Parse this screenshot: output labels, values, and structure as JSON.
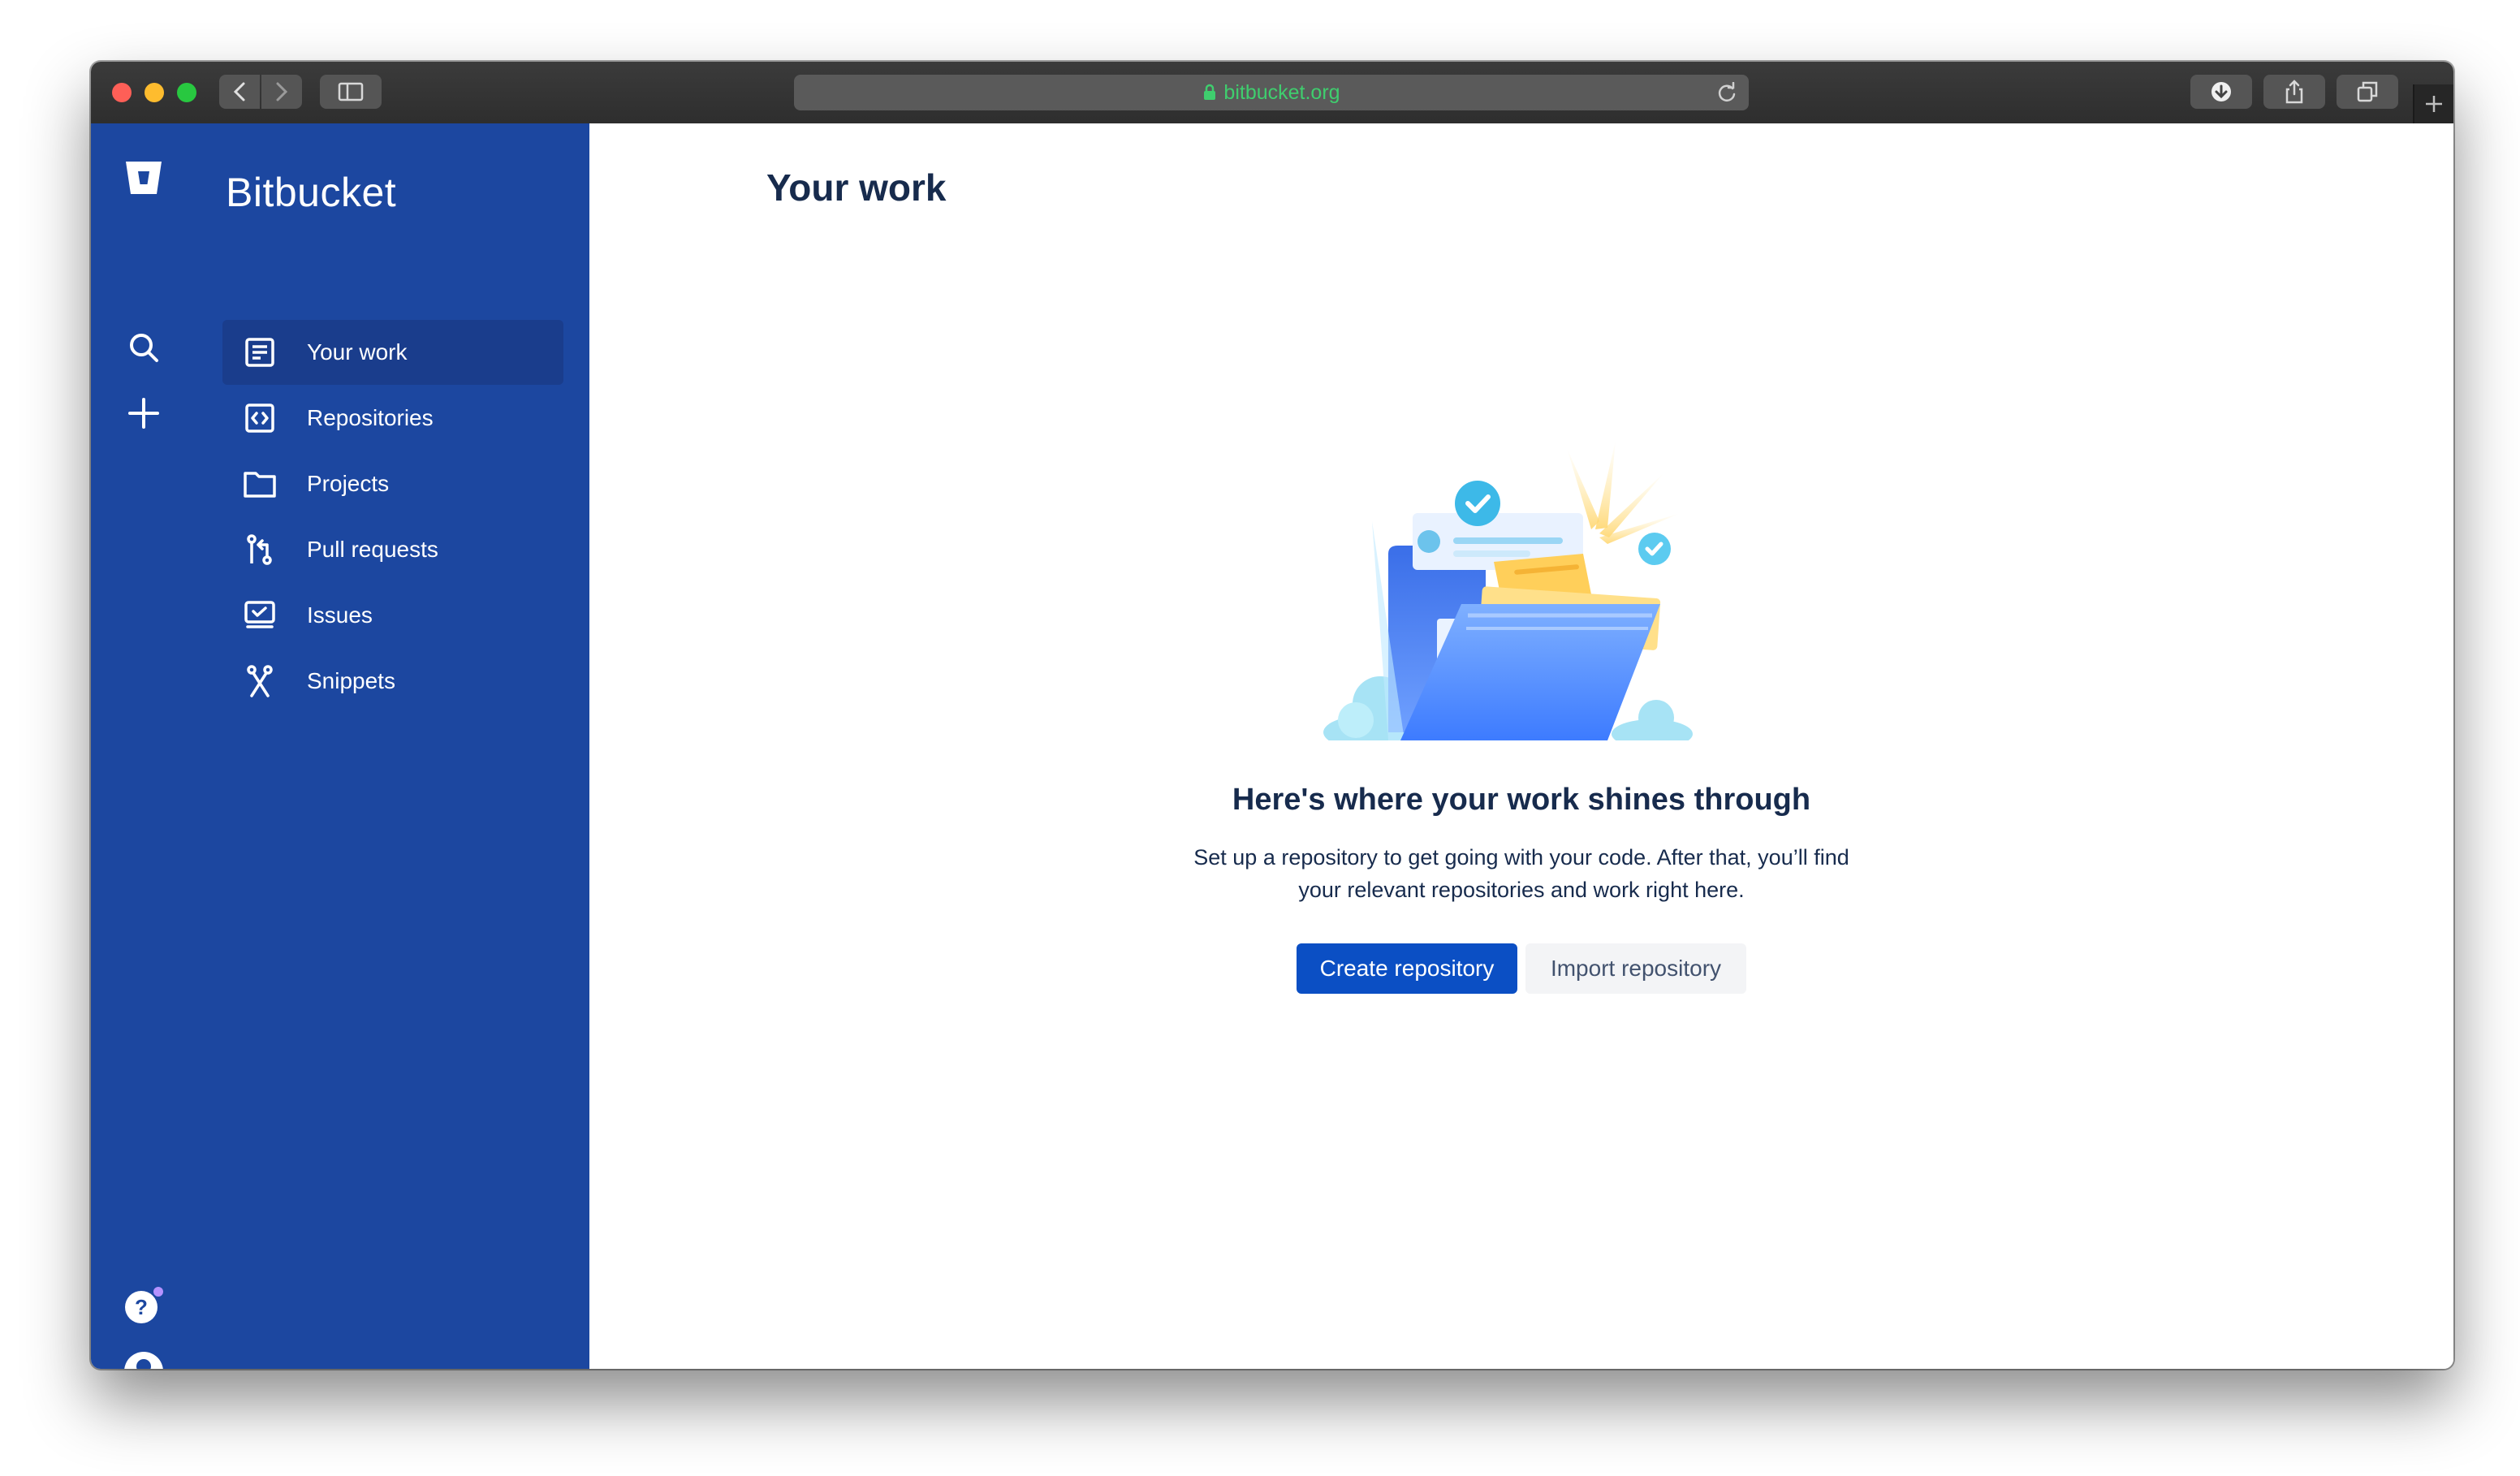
{
  "browser": {
    "url": "bitbucket.org",
    "colors": {
      "url_text": "#3fce6e",
      "chrome": "#333333"
    },
    "icons": [
      "back-icon",
      "forward-icon",
      "sidebar-toggle-icon",
      "lock-icon",
      "reload-icon",
      "download-icon",
      "share-icon",
      "tabs-icon",
      "new-tab-icon"
    ]
  },
  "sidebar": {
    "brand": "Bitbucket",
    "global_icons": [
      "bitbucket-logo-icon",
      "search-icon",
      "create-icon",
      "help-icon",
      "profile-icon"
    ],
    "items": [
      {
        "label": "Your work",
        "icon": "your-work-icon",
        "active": true
      },
      {
        "label": "Repositories",
        "icon": "repositories-icon"
      },
      {
        "label": "Projects",
        "icon": "projects-icon"
      },
      {
        "label": "Pull requests",
        "icon": "pull-requests-icon"
      },
      {
        "label": "Issues",
        "icon": "issues-icon"
      },
      {
        "label": "Snippets",
        "icon": "snippets-icon"
      }
    ],
    "colors": {
      "background": "#1c47a0",
      "active": "#1a3d8c"
    }
  },
  "main": {
    "title": "Your work",
    "empty_state": {
      "heading": "Here's where your work shines through",
      "body_line1": "Set up a repository to get going with your code. After that, you’ll find",
      "body_line2": "your relevant repositories and work right here.",
      "primary_button": "Create repository",
      "secondary_button": "Import repository"
    },
    "colors": {
      "primary_button": "#0b4fc4",
      "heading": "#172b4d"
    }
  }
}
